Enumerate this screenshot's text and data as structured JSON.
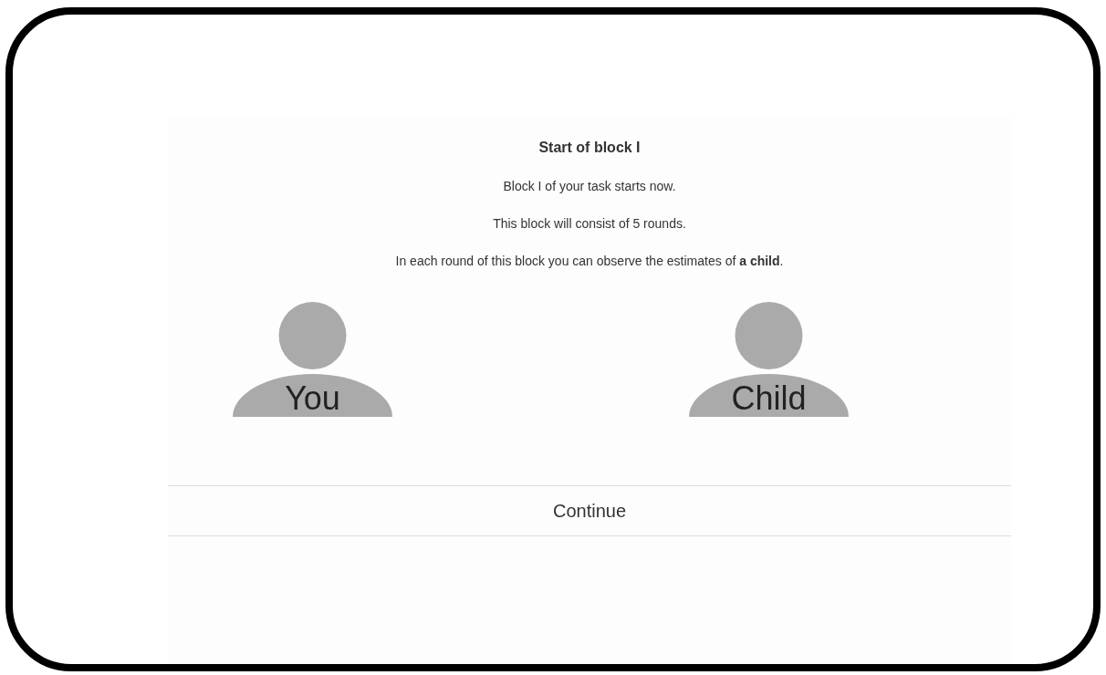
{
  "title": "Start of block I",
  "paragraphs": [
    "Block I of your task starts now.",
    "This block will consist of 5 rounds.",
    "In each round of this block you can observe the estimates of **a child**."
  ],
  "persons": [
    {
      "label": "You"
    },
    {
      "label": "Child"
    }
  ],
  "button": {
    "label": "Continue"
  }
}
